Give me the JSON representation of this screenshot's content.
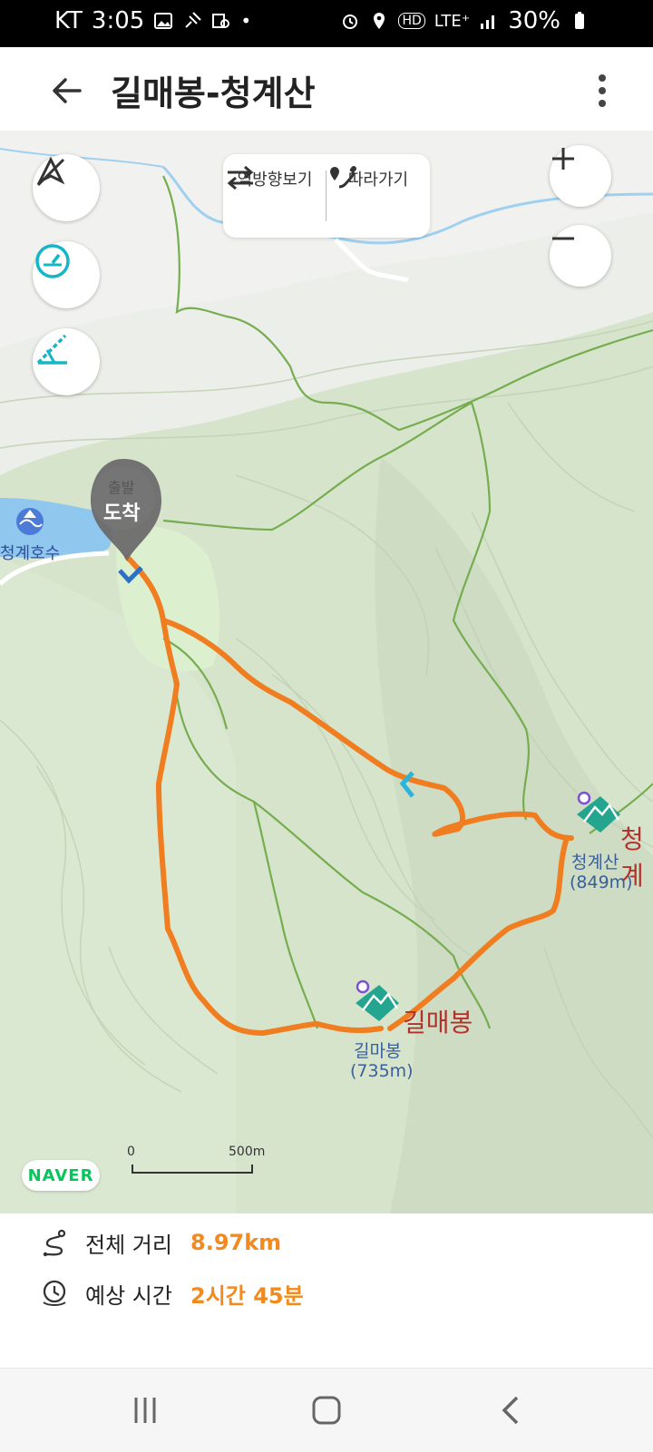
{
  "status_bar": {
    "carrier": "KT",
    "time": "3:05",
    "network": "LTE⁺",
    "hd": "HD",
    "battery": "30%"
  },
  "header": {
    "title": "길매봉-청계산"
  },
  "map": {
    "reverse_label": "역방향보기",
    "follow_label": "따라가기",
    "marker_top": "출발",
    "marker_main": "도착",
    "places": {
      "lake": "청계호수",
      "peak1_big": "길매봉",
      "peak1_name": "길마봉",
      "peak1_elev": "(735m)",
      "peak2_big": "청계",
      "peak2_name": "청계산",
      "peak2_elev": "(849m)"
    },
    "brand": "NAVER",
    "scale": {
      "start": "0",
      "end": "500m"
    },
    "colors": {
      "route": "#f07d20",
      "trail": "#6aa84f",
      "water": "#8fc7ef",
      "accent_teal": "#1abaa6"
    }
  },
  "summary": {
    "distance_label": "전체 거리",
    "distance_value": "8.97km",
    "time_label": "예상 시간",
    "time_value": "2시간 45분"
  },
  "nav": {
    "icons": [
      "recent-apps-icon",
      "home-icon",
      "back-icon"
    ]
  }
}
